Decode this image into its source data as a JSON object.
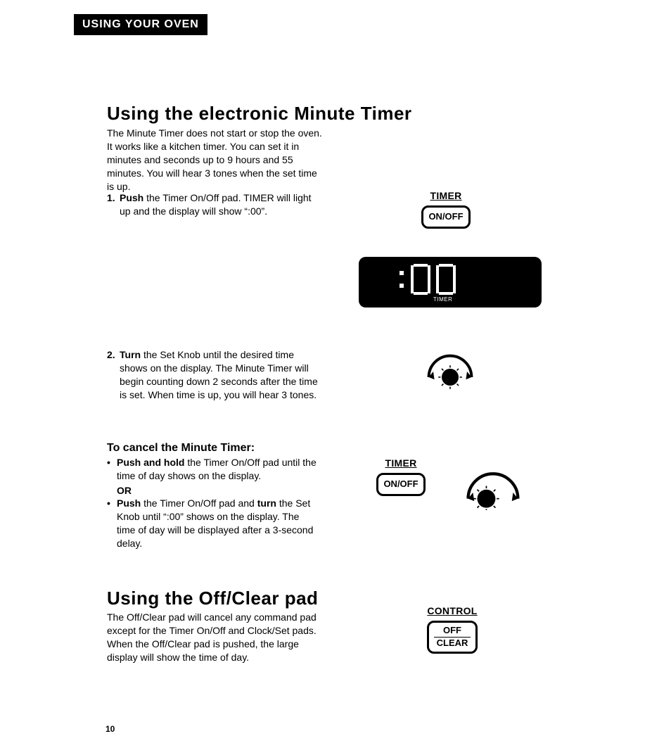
{
  "chapter": "USING YOUR OVEN",
  "page_number": "10",
  "timer_section": {
    "heading": "Using the electronic Minute Timer",
    "intro": "The Minute Timer does not start or stop the oven. It works like a kitchen timer. You can set it in minutes and seconds up to 9 hours and 55 minutes. You will hear 3 tones when the set time is up.",
    "step1_a": "Push",
    "step1_b": " the Timer On/Off pad. TIMER will light up and the display will show “:00”.",
    "step2_a": "Turn",
    "step2_b": " the Set Knob until the desired time shows on the display. The Minute Timer will begin counting down 2 seconds after the time is set. When time is up, you will hear 3 tones.",
    "cancel_heading": "To cancel the Minute Timer:",
    "cancel1_a": "Push and hold",
    "cancel1_b": " the Timer On/Off pad until the time of day shows on the display.",
    "cancel_or": "OR",
    "cancel2_a": "Push",
    "cancel2_b": " the Timer On/Off pad and ",
    "cancel2_c": "turn",
    "cancel2_d": " the Set Knob until “:00” shows on the display. The time of day will be displayed after a 3-second delay."
  },
  "offclear_section": {
    "heading": "Using the Off/Clear pad",
    "body": "The Off/Clear pad will cancel any command pad except for the Timer On/Off and Clock/Set pads. When the Off/Clear pad is pushed, the large display will show the time of day."
  },
  "labels": {
    "timer": "TIMER",
    "onoff": "ON/OFF",
    "control": "CONTROL",
    "off": "OFF",
    "clear": "CLEAR",
    "display_timer": "TIMER"
  }
}
